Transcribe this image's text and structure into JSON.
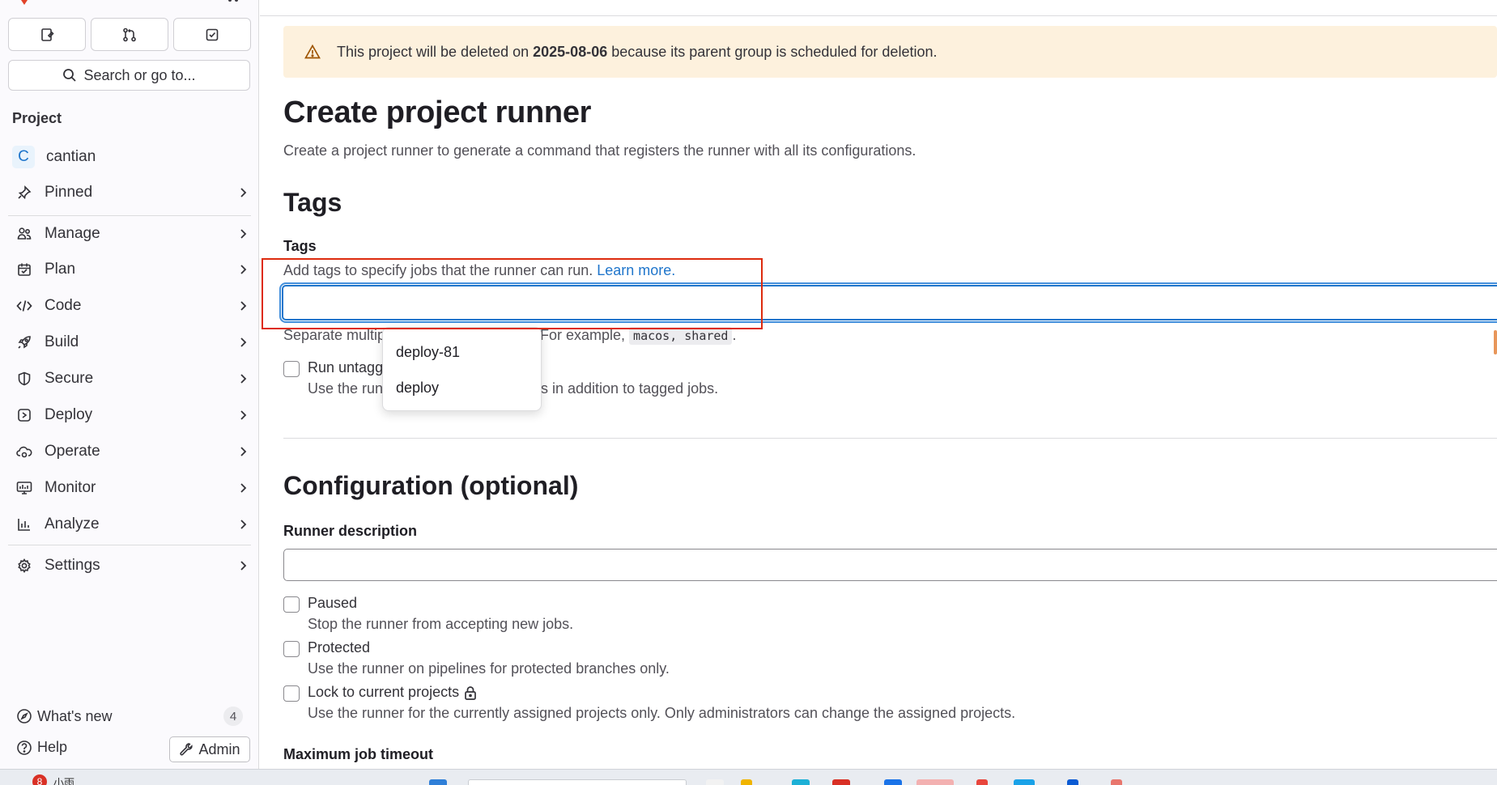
{
  "sidebar": {
    "quick_actions": [
      {
        "name": "issues-icon"
      },
      {
        "name": "merge-requests-icon"
      },
      {
        "name": "todos-icon"
      }
    ],
    "search_label": "Search or go to...",
    "section_title": "Project",
    "project": {
      "initial": "C",
      "name": "cantian"
    },
    "items": [
      {
        "label": "Pinned",
        "icon": "pin-icon"
      },
      {
        "label": "Manage",
        "icon": "users-icon"
      },
      {
        "label": "Plan",
        "icon": "calendar-icon"
      },
      {
        "label": "Code",
        "icon": "code-icon"
      },
      {
        "label": "Build",
        "icon": "rocket-icon"
      },
      {
        "label": "Secure",
        "icon": "shield-icon"
      },
      {
        "label": "Deploy",
        "icon": "deployments-icon"
      },
      {
        "label": "Operate",
        "icon": "cloud-gear-icon"
      },
      {
        "label": "Monitor",
        "icon": "monitor-icon"
      },
      {
        "label": "Analyze",
        "icon": "chart-icon"
      },
      {
        "label": "Settings",
        "icon": "gear-icon"
      }
    ],
    "whats_new": {
      "label": "What's new",
      "count": "4"
    },
    "help_label": "Help",
    "admin_label": "Admin"
  },
  "alert": {
    "prefix": "This project will be deleted on ",
    "date": "2025-08-06",
    "suffix": " because its parent group is scheduled for deletion."
  },
  "page": {
    "title": "Create project runner",
    "description": "Create a project runner to generate a command that registers the runner with all its configurations."
  },
  "tags_section": {
    "heading": "Tags",
    "label": "Tags",
    "help_prefix": "Add tags to specify jobs that the runner can run. ",
    "help_link": "Learn more.",
    "input_value": "",
    "separator_help_start": "Separate multip",
    "separator_help_end": "For example, ",
    "example_code": "macos, shared",
    "example_end": ".",
    "run_untagged_label": "Run untagg",
    "run_untagged_help_start": "Use the run",
    "run_untagged_help_end": "s in addition to tagged jobs.",
    "suggestions": [
      "deploy-81",
      "deploy"
    ]
  },
  "config_section": {
    "heading": "Configuration (optional)",
    "description_label": "Runner description",
    "description_value": "",
    "options": [
      {
        "label": "Paused",
        "help": "Stop the runner from accepting new jobs."
      },
      {
        "label": "Protected",
        "help": "Use the runner on pipelines for protected branches only."
      },
      {
        "label": "Lock to current projects",
        "help": "Use the runner for the currently assigned projects only. Only administrators can change the assigned projects."
      }
    ],
    "timeout_label": "Maximum job timeout"
  },
  "taskbar": {
    "badge": "8",
    "text": "小雨"
  },
  "colors": {
    "accent": "#1f75cb",
    "alert_bg": "#fdf1dd",
    "highlight_box": "#dd2b0e"
  }
}
